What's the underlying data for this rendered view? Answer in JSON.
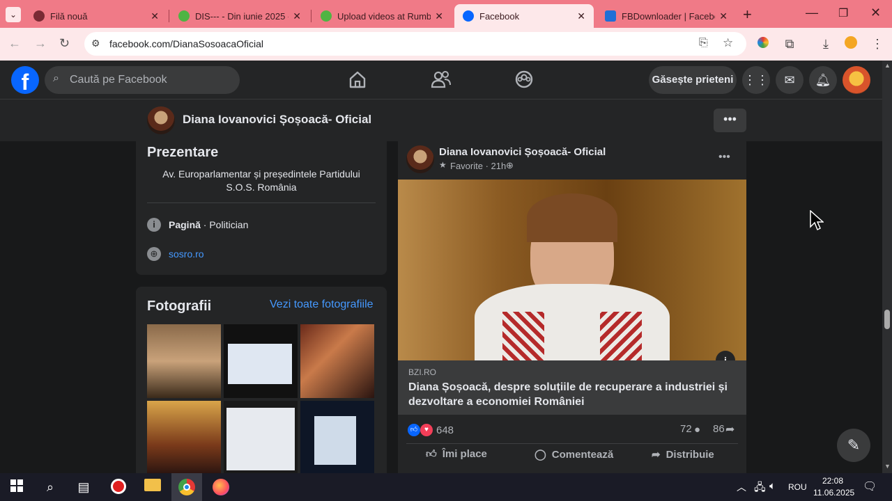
{
  "browser": {
    "tabs": [
      {
        "label": "Filă nouă",
        "active": false
      },
      {
        "label": "DIS--- - Din iunie 2025 -",
        "active": false
      },
      {
        "label": "Upload videos at Rumble",
        "active": false
      },
      {
        "label": "Facebook",
        "active": true
      },
      {
        "label": "FBDownloader | Faceboo",
        "active": false
      }
    ],
    "url": "facebook.com/DianaSosoacaOficial"
  },
  "fb_header": {
    "search_placeholder": "Caută pe Facebook",
    "find_friends": "Găsește prieteni"
  },
  "page_bar": {
    "name": "Diana Iovanovici Șoșoacă- Oficial"
  },
  "intro": {
    "title": "Prezentare",
    "bio": "Av. Europarlamentar și președintele Partidului S.O.S. România",
    "category_bold": "Pagină",
    "category_rest": " · Politician",
    "website": "sosro.ro"
  },
  "photos": {
    "title": "Fotografii",
    "see_all": "Vezi toate fotografiile"
  },
  "post": {
    "author": "Diana Iovanovici Șoșoacă- Oficial",
    "meta": "Favorite · 21h ·",
    "source": "BZI.RO",
    "headline": "Diana Șoșoacă, despre soluțiile de recuperare a industriei și dezvoltare a economiei României",
    "reactions": "648",
    "comments": "72",
    "shares": "86",
    "like_label": "Îmi place",
    "comment_label": "Comentează",
    "share_label": "Distribuie"
  },
  "taskbar": {
    "language": "ROU",
    "time": "22:08",
    "date": "11.06.2025"
  },
  "colors": {
    "fb_blue": "#0866ff",
    "tab_strip": "#f07a87",
    "dark_bg": "#18191a",
    "card_bg": "#242526"
  }
}
